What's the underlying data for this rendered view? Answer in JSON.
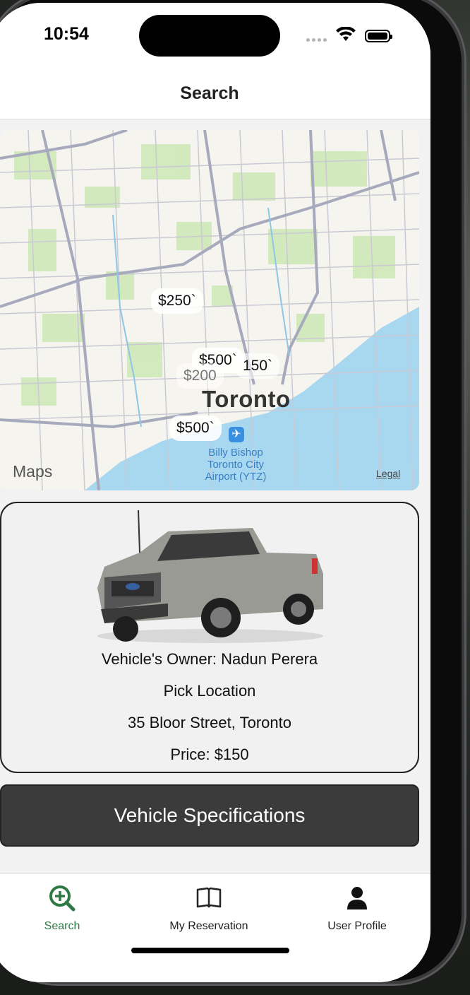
{
  "status_bar": {
    "time": "10:54"
  },
  "header": {
    "title": "Search"
  },
  "map": {
    "pins": [
      {
        "label": "$250`"
      },
      {
        "label": "$500`"
      },
      {
        "label": "150`"
      },
      {
        "label": "$200"
      },
      {
        "label": "$500`"
      }
    ],
    "city_label": "Toronto",
    "airport_label": "Billy Bishop Toronto City Airport (YTZ)",
    "attribution": "Maps",
    "legal": "Legal"
  },
  "vehicle_card": {
    "owner": "Vehicle's Owner: Nadun Perera",
    "pick_label": "Pick Location",
    "address": "35 Bloor Street, Toronto",
    "price": "Price: $150"
  },
  "actions": {
    "specifications": "Vehicle Specifications"
  },
  "tab_bar": {
    "tabs": [
      {
        "label": "Search",
        "icon": "search-plus-icon",
        "active": true
      },
      {
        "label": "My Reservation",
        "icon": "book-icon",
        "active": false
      },
      {
        "label": "User Profile",
        "icon": "person-icon",
        "active": false
      }
    ]
  },
  "colors": {
    "accent": "#2f7a45",
    "button_bg": "#3b3b3b",
    "water": "#a8d8f0"
  }
}
